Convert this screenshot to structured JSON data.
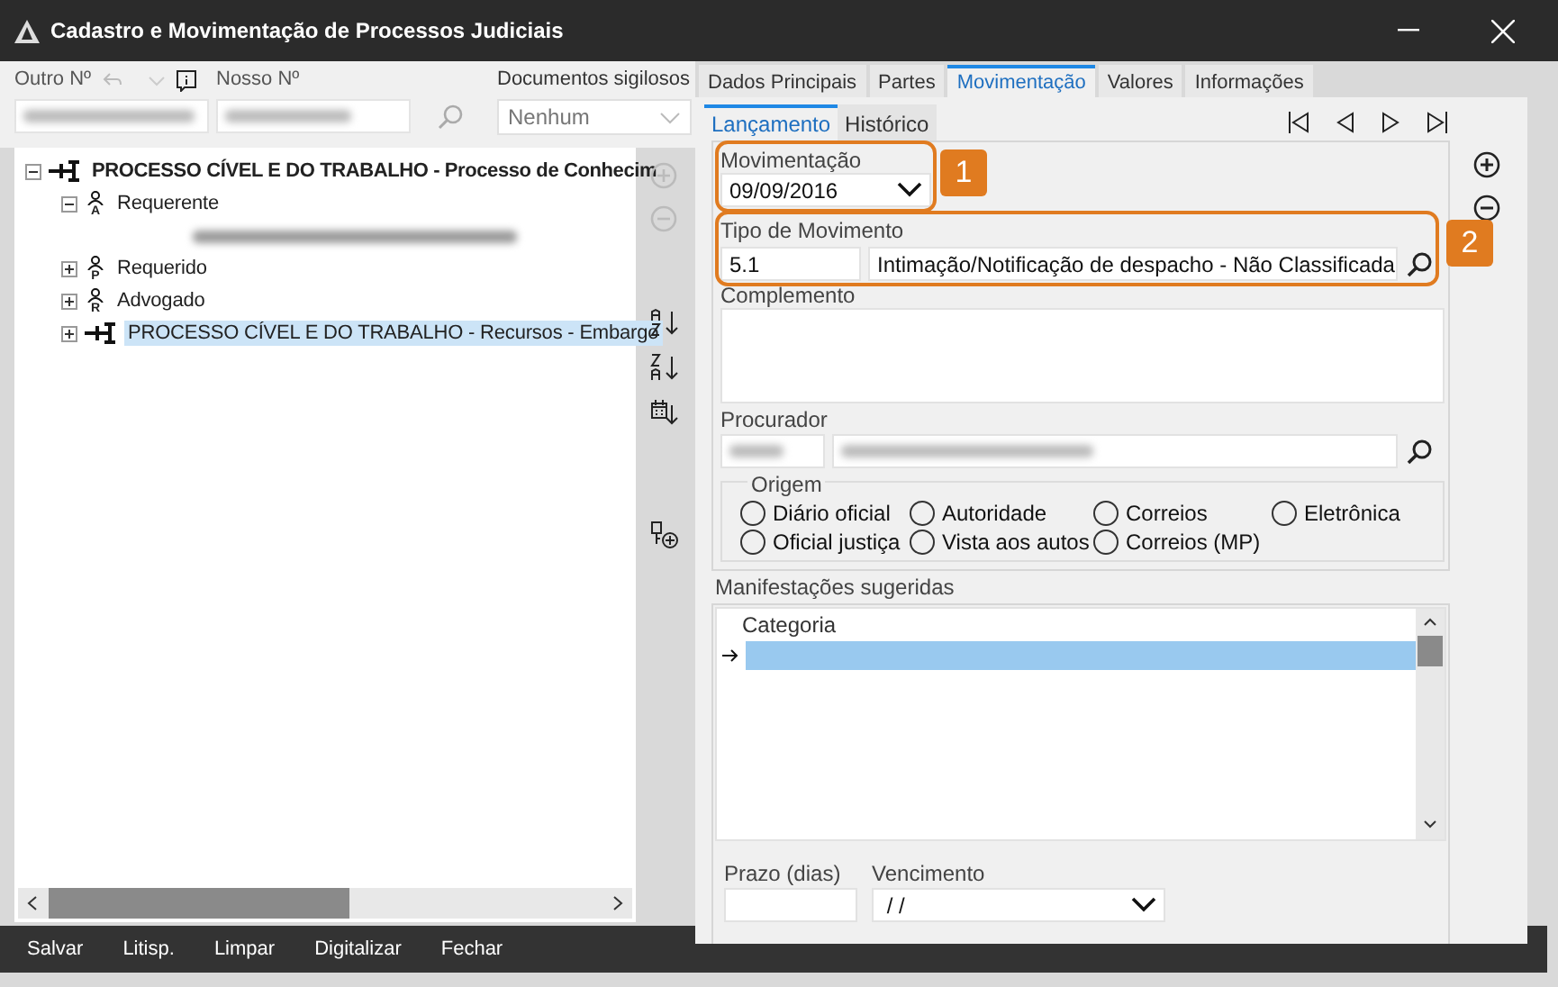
{
  "window": {
    "title": "Cadastro e Movimentação de Processos Judiciais"
  },
  "header": {
    "outro_label": "Outro Nº",
    "nosso_label": "Nosso Nº",
    "sigilosos_label": "Documentos sigilosos",
    "sigilosos_value": "Nenhum"
  },
  "tree": [
    {
      "label": "PROCESSO CÍVEL E DO TRABALHO - Processo de Conhecim",
      "kind": "process",
      "expanded": true,
      "selected": false,
      "children": [
        {
          "label": "Requerente",
          "kind": "person",
          "badge": "A",
          "expanded": true,
          "selected": false,
          "children": [
            {
              "kind": "blurred"
            }
          ]
        },
        {
          "label": "Requerido",
          "kind": "person",
          "badge": "P",
          "expanded": false,
          "selected": false
        },
        {
          "label": "Advogado",
          "kind": "person",
          "badge": "R",
          "expanded": false,
          "selected": false
        },
        {
          "label": "PROCESSO CÍVEL E DO TRABALHO - Recursos - Embargo",
          "kind": "process",
          "expanded": false,
          "selected": true
        }
      ]
    }
  ],
  "tabs": [
    {
      "label": "Dados Principais",
      "selected": false
    },
    {
      "label": "Partes",
      "selected": false
    },
    {
      "label": "Movimentação",
      "selected": true
    },
    {
      "label": "Valores",
      "selected": false
    },
    {
      "label": "Informações",
      "selected": false
    }
  ],
  "subtabs": [
    {
      "label": "Lançamento",
      "selected": true
    },
    {
      "label": "Histórico",
      "selected": false
    }
  ],
  "movimentacao": {
    "label": "Movimentação",
    "value": "09/09/2016",
    "callout": "1"
  },
  "tipo": {
    "label": "Tipo de Movimento",
    "code": "5.1",
    "description": "Intimação/Notificação de despacho - Não Classificada",
    "callout": "2"
  },
  "complemento": {
    "label": "Complemento"
  },
  "procurador": {
    "label": "Procurador"
  },
  "origem": {
    "label": "Origem",
    "options": [
      {
        "label": "Diário oficial",
        "selected": false
      },
      {
        "label": "Autoridade",
        "selected": false
      },
      {
        "label": "Correios",
        "selected": false
      },
      {
        "label": "Eletrônica",
        "selected": false
      },
      {
        "label": "Oficial justiça",
        "selected": false
      },
      {
        "label": "Vista aos autos",
        "selected": false
      },
      {
        "label": "Correios (MP)",
        "selected": false
      }
    ]
  },
  "manifestacoes": {
    "label": "Manifestações sugeridas",
    "column": "Categoria",
    "rows": [
      {
        "selected": true
      }
    ]
  },
  "prazo": {
    "label": "Prazo (dias)"
  },
  "vencimento": {
    "label": "Vencimento",
    "value": " / /"
  },
  "actions": [
    "Salvar",
    "Litisp.",
    "Limpar",
    "Digitalizar",
    "Fechar"
  ]
}
